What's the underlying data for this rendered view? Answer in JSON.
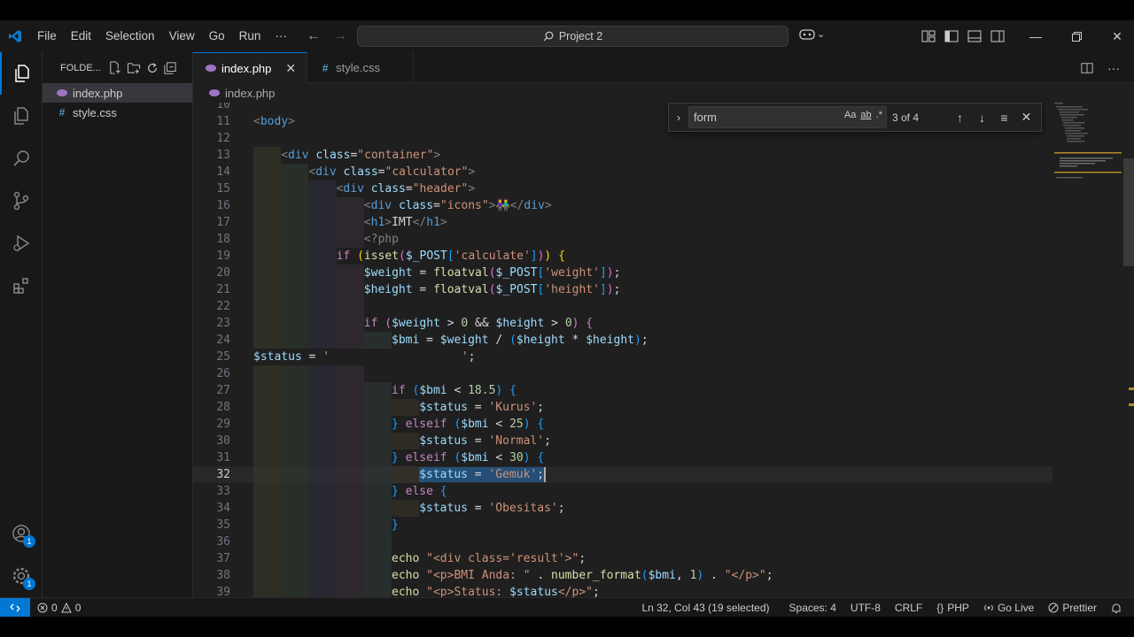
{
  "titlebar": {
    "menu": [
      "File",
      "Edit",
      "Selection",
      "View",
      "Go",
      "Run",
      "···"
    ],
    "search": "Project 2"
  },
  "sidebar": {
    "title": "FOLDE...",
    "files": [
      {
        "name": "index.php",
        "type": "php",
        "selected": true
      },
      {
        "name": "style.css",
        "type": "css",
        "selected": false
      }
    ]
  },
  "tabs": [
    {
      "label": "index.php",
      "type": "php",
      "active": true
    },
    {
      "label": "style.css",
      "type": "css",
      "active": false
    }
  ],
  "breadcrumb": "index.php",
  "find": {
    "query": "form",
    "match_case": "Aa",
    "whole_word": "ab",
    "regex": ".*",
    "count": "3 of 4"
  },
  "code_lines": [
    {
      "n": "10",
      "indent": 0,
      "tokens": []
    },
    {
      "n": "11",
      "indent": 0,
      "tokens": [
        [
          "tg",
          "<"
        ],
        [
          "tn",
          "body"
        ],
        [
          "tg",
          ">"
        ]
      ]
    },
    {
      "n": "12",
      "indent": 0,
      "tokens": []
    },
    {
      "n": "13",
      "indent": 1,
      "tokens": [
        [
          "tg",
          "<"
        ],
        [
          "tn",
          "div "
        ],
        [
          "at",
          "class"
        ],
        [
          "pu",
          "="
        ],
        [
          "st",
          "\"container\""
        ],
        [
          "tg",
          ">"
        ]
      ]
    },
    {
      "n": "14",
      "indent": 2,
      "tokens": [
        [
          "tg",
          "<"
        ],
        [
          "tn",
          "div "
        ],
        [
          "at",
          "class"
        ],
        [
          "pu",
          "="
        ],
        [
          "st",
          "\"calculator\""
        ],
        [
          "tg",
          ">"
        ]
      ]
    },
    {
      "n": "15",
      "indent": 3,
      "tokens": [
        [
          "tg",
          "<"
        ],
        [
          "tn",
          "div "
        ],
        [
          "at",
          "class"
        ],
        [
          "pu",
          "="
        ],
        [
          "st",
          "\"header\""
        ],
        [
          "tg",
          ">"
        ]
      ]
    },
    {
      "n": "16",
      "indent": 4,
      "tokens": [
        [
          "tg",
          "<"
        ],
        [
          "tn",
          "div "
        ],
        [
          "at",
          "class"
        ],
        [
          "pu",
          "="
        ],
        [
          "st",
          "\"icons\""
        ],
        [
          "tg",
          ">"
        ],
        [
          "pu",
          "👫"
        ],
        [
          "tg",
          "</"
        ],
        [
          "tn",
          "div"
        ],
        [
          "tg",
          ">"
        ]
      ]
    },
    {
      "n": "17",
      "indent": 4,
      "tokens": [
        [
          "tg",
          "<"
        ],
        [
          "tn",
          "h1"
        ],
        [
          "tg",
          ">"
        ],
        [
          "pu",
          "IMT"
        ],
        [
          "tg",
          "</"
        ],
        [
          "tn",
          "h1"
        ],
        [
          "tg",
          ">"
        ]
      ]
    },
    {
      "n": "18",
      "indent": 4,
      "tokens": [
        [
          "tg",
          "<?php"
        ]
      ]
    },
    {
      "n": "19",
      "indent": 3,
      "tokens": [
        [
          "kw",
          "if "
        ],
        [
          "br1",
          "("
        ],
        [
          "fn",
          "isset"
        ],
        [
          "br2",
          "("
        ],
        [
          "vr",
          "$_POST"
        ],
        [
          "br3",
          "["
        ],
        [
          "st",
          "'calculate'"
        ],
        [
          "br3",
          "]"
        ],
        [
          "br2",
          ")"
        ],
        [
          "br1",
          ")"
        ],
        [
          "pu",
          " "
        ],
        [
          "br1",
          "{"
        ]
      ]
    },
    {
      "n": "20",
      "indent": 4,
      "tokens": [
        [
          "vr",
          "$weight"
        ],
        [
          "pu",
          " = "
        ],
        [
          "fn",
          "floatval"
        ],
        [
          "br2",
          "("
        ],
        [
          "vr",
          "$_POST"
        ],
        [
          "br3",
          "["
        ],
        [
          "st",
          "'weight'"
        ],
        [
          "br3",
          "]"
        ],
        [
          "br2",
          ")"
        ],
        [
          "pu",
          ";"
        ]
      ]
    },
    {
      "n": "21",
      "indent": 4,
      "tokens": [
        [
          "vr",
          "$height"
        ],
        [
          "pu",
          " = "
        ],
        [
          "fn",
          "floatval"
        ],
        [
          "br2",
          "("
        ],
        [
          "vr",
          "$_POST"
        ],
        [
          "br3",
          "["
        ],
        [
          "st",
          "'height'"
        ],
        [
          "br3",
          "]"
        ],
        [
          "br2",
          ")"
        ],
        [
          "pu",
          ";"
        ]
      ]
    },
    {
      "n": "22",
      "indent": 4,
      "tokens": []
    },
    {
      "n": "23",
      "indent": 4,
      "tokens": [
        [
          "kw",
          "if "
        ],
        [
          "br2",
          "("
        ],
        [
          "vr",
          "$weight"
        ],
        [
          "pu",
          " > "
        ],
        [
          "nm",
          "0"
        ],
        [
          "pu",
          " && "
        ],
        [
          "vr",
          "$height"
        ],
        [
          "pu",
          " > "
        ],
        [
          "nm",
          "0"
        ],
        [
          "br2",
          ")"
        ],
        [
          "pu",
          " "
        ],
        [
          "br2",
          "{"
        ]
      ]
    },
    {
      "n": "24",
      "indent": 5,
      "tokens": [
        [
          "vr",
          "$bmi"
        ],
        [
          "pu",
          " = "
        ],
        [
          "vr",
          "$weight"
        ],
        [
          "pu",
          " / "
        ],
        [
          "br3",
          "("
        ],
        [
          "vr",
          "$height"
        ],
        [
          "pu",
          " * "
        ],
        [
          "vr",
          "$height"
        ],
        [
          "br3",
          ")"
        ],
        [
          "pu",
          ";"
        ]
      ]
    },
    {
      "n": "25",
      "indent": 0,
      "tokens": [
        [
          "vr",
          "$status"
        ],
        [
          "pu",
          " = "
        ],
        [
          "st",
          "'                   '"
        ],
        [
          "pu",
          ";"
        ]
      ]
    },
    {
      "n": "26",
      "indent": 4,
      "tokens": []
    },
    {
      "n": "27",
      "indent": 5,
      "tokens": [
        [
          "kw",
          "if "
        ],
        [
          "br3",
          "("
        ],
        [
          "vr",
          "$bmi"
        ],
        [
          "pu",
          " < "
        ],
        [
          "nm",
          "18.5"
        ],
        [
          "br3",
          ")"
        ],
        [
          "pu",
          " "
        ],
        [
          "br3",
          "{"
        ]
      ]
    },
    {
      "n": "28",
      "indent": 6,
      "tokens": [
        [
          "vr",
          "$status"
        ],
        [
          "pu",
          " = "
        ],
        [
          "st",
          "'Kurus'"
        ],
        [
          "pu",
          ";"
        ]
      ]
    },
    {
      "n": "29",
      "indent": 5,
      "tokens": [
        [
          "br3",
          "}"
        ],
        [
          "kw",
          " elseif "
        ],
        [
          "br3",
          "("
        ],
        [
          "vr",
          "$bmi"
        ],
        [
          "pu",
          " < "
        ],
        [
          "nm",
          "25"
        ],
        [
          "br3",
          ")"
        ],
        [
          "pu",
          " "
        ],
        [
          "br3",
          "{"
        ]
      ]
    },
    {
      "n": "30",
      "indent": 6,
      "tokens": [
        [
          "vr",
          "$status"
        ],
        [
          "pu",
          " = "
        ],
        [
          "st",
          "'Normal'"
        ],
        [
          "pu",
          ";"
        ]
      ]
    },
    {
      "n": "31",
      "indent": 5,
      "tokens": [
        [
          "br3",
          "}"
        ],
        [
          "kw",
          " elseif "
        ],
        [
          "br3",
          "("
        ],
        [
          "vr",
          "$bmi"
        ],
        [
          "pu",
          " < "
        ],
        [
          "nm",
          "30"
        ],
        [
          "br3",
          ")"
        ],
        [
          "pu",
          " "
        ],
        [
          "br3",
          "{"
        ]
      ]
    },
    {
      "n": "32",
      "indent": 6,
      "current": true,
      "tokens": [
        [
          "vr",
          "$status"
        ],
        [
          "pu",
          " = "
        ],
        [
          "st",
          "'Gemuk'"
        ],
        [
          "pu",
          ";"
        ]
      ]
    },
    {
      "n": "33",
      "indent": 5,
      "tokens": [
        [
          "br3",
          "}"
        ],
        [
          "kw",
          " else "
        ],
        [
          "br3",
          "{"
        ]
      ]
    },
    {
      "n": "34",
      "indent": 6,
      "tokens": [
        [
          "vr",
          "$status"
        ],
        [
          "pu",
          " = "
        ],
        [
          "st",
          "'Obesitas'"
        ],
        [
          "pu",
          ";"
        ]
      ]
    },
    {
      "n": "35",
      "indent": 5,
      "tokens": [
        [
          "br3",
          "}"
        ]
      ]
    },
    {
      "n": "36",
      "indent": 5,
      "tokens": []
    },
    {
      "n": "37",
      "indent": 5,
      "tokens": [
        [
          "fn",
          "echo "
        ],
        [
          "st",
          "\"<div class='result'>\""
        ],
        [
          "pu",
          ";"
        ]
      ]
    },
    {
      "n": "38",
      "indent": 5,
      "tokens": [
        [
          "fn",
          "echo "
        ],
        [
          "st",
          "\"<p>BMI Anda: \""
        ],
        [
          "pu",
          " . "
        ],
        [
          "fn",
          "number_format"
        ],
        [
          "br3",
          "("
        ],
        [
          "vr",
          "$bmi"
        ],
        [
          "pu",
          ", "
        ],
        [
          "nm",
          "1"
        ],
        [
          "br3",
          ")"
        ],
        [
          "pu",
          " . "
        ],
        [
          "st",
          "\"</p>\""
        ],
        [
          "pu",
          ";"
        ]
      ]
    },
    {
      "n": "39",
      "indent": 5,
      "tokens": [
        [
          "fn",
          "echo "
        ],
        [
          "st",
          "\"<p>Status: "
        ],
        [
          "vr",
          "$status"
        ],
        [
          "st",
          "</p>\""
        ],
        [
          "pu",
          ";"
        ]
      ]
    }
  ],
  "statusbar": {
    "errors": "0",
    "warnings": "0",
    "position": "Ln 32, Col 43 (19 selected)",
    "spaces": "Spaces: 4",
    "encoding": "UTF-8",
    "eol": "CRLF",
    "language": "PHP",
    "golive": "Go Live",
    "prettier": "Prettier"
  },
  "badges": {
    "accounts": "1",
    "settings": "1"
  },
  "colors": {
    "accent": "#0078d4",
    "editor_bg": "#1f1f1f",
    "selection": "#264f78"
  }
}
